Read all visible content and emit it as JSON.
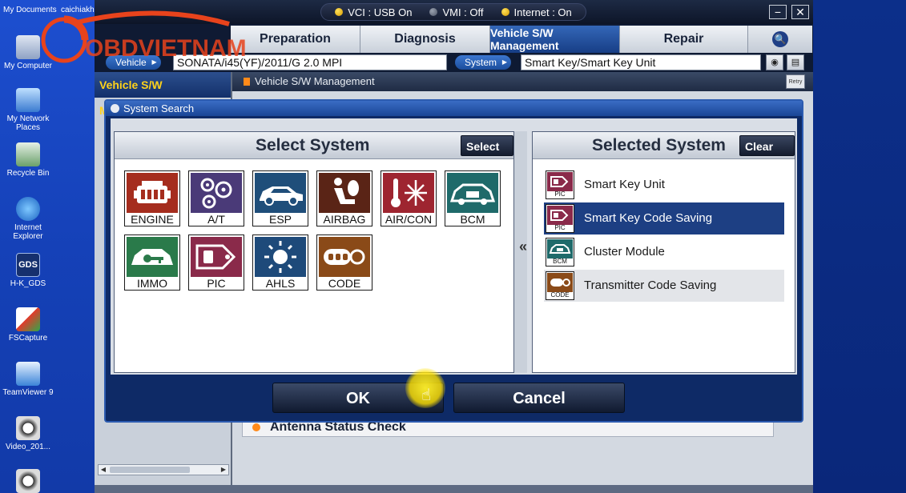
{
  "desktop": {
    "top_labels": [
      "My Documents",
      "caichiakh"
    ],
    "icons": [
      {
        "label": "My Computer",
        "icon": "my-computer-icon"
      },
      {
        "label": "My Network Places",
        "icon": "network-icon"
      },
      {
        "label": "Recycle Bin",
        "icon": "recycle-bin-icon"
      },
      {
        "label": "Internet Explorer",
        "icon": "internet-explorer-icon"
      },
      {
        "label": "H-K_GDS",
        "icon_text": "GDS"
      },
      {
        "label": "FSCapture",
        "icon": "fscapture-icon"
      },
      {
        "label": "TeamViewer 9",
        "icon": "teamviewer-icon"
      },
      {
        "label": "Video_201...",
        "icon": "video-icon"
      }
    ]
  },
  "status": {
    "vci": "VCI : USB On",
    "vmi": "VMI : Off",
    "internet": "Internet : On"
  },
  "window_controls": {
    "minimize": "−",
    "close": "✕"
  },
  "nav": {
    "tabs": [
      {
        "label": "Preparation",
        "active": false
      },
      {
        "label": "Diagnosis",
        "active": false
      },
      {
        "label": "Vehicle S/W Management",
        "active": true
      },
      {
        "label": "Repair",
        "active": false
      }
    ],
    "search_glyph": "🔍"
  },
  "vehicle_row": {
    "vehicle_label": "Vehicle",
    "vehicle_value": "SONATA/i45(YF)/2011/G 2.0 MPI",
    "system_label": "System",
    "system_value": "Smart Key/Smart Key Unit"
  },
  "left_panel": {
    "title": "Vehicle S/W Management"
  },
  "main_panel": {
    "header": "Vehicle S/W Management",
    "retry_label": "Retry",
    "antenna_row": "Antenna Status Check"
  },
  "modal": {
    "title": "System Search",
    "select_panel": {
      "title": "Select System",
      "button": "Select All",
      "tiles": [
        {
          "label": "ENGINE",
          "color": "#a52d1e"
        },
        {
          "label": "A/T",
          "color": "#4a3a78"
        },
        {
          "label": "ESP",
          "color": "#1f4e7a"
        },
        {
          "label": "AIRBAG",
          "color": "#5a2416"
        },
        {
          "label": "AIR/CON",
          "color": "#9e2530"
        },
        {
          "label": "BCM",
          "color": "#1f6a6a"
        },
        {
          "label": "IMMO",
          "color": "#2a7a4a"
        },
        {
          "label": "PIC",
          "color": "#8a2a4a"
        },
        {
          "label": "AHLS",
          "color": "#1e4a7a"
        },
        {
          "label": "CODE",
          "color": "#8a4a18"
        }
      ]
    },
    "selected_panel": {
      "title": "Selected System",
      "button": "Clear All",
      "items": [
        {
          "label": "Smart Key Unit",
          "tag": "PIC",
          "color": "#8a2a4a",
          "state": "normal"
        },
        {
          "label": "Smart Key Code Saving",
          "tag": "PIC",
          "color": "#8a2a4a",
          "state": "active"
        },
        {
          "label": "Cluster Module",
          "tag": "BCM",
          "color": "#1f6a6a",
          "state": "normal"
        },
        {
          "label": "Transmitter Code Saving",
          "tag": "CODE",
          "color": "#8a4a18",
          "state": "alt"
        }
      ]
    },
    "collapse_glyph": "«",
    "ok_label": "OK",
    "cancel_label": "Cancel"
  },
  "watermark": {
    "text": "OBDVIETNAM"
  }
}
